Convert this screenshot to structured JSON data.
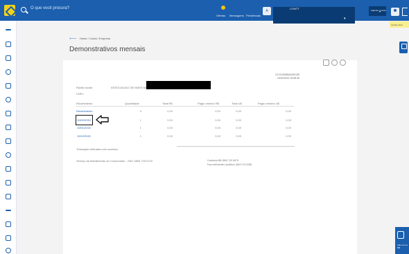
{
  "topbar": {
    "search_placeholder": "O que você procura?",
    "links": [
      "Ofertas",
      "Mensagens",
      "Pendências"
    ],
    "agency_initial": "A",
    "account_label": "CONTT",
    "user_label": "Agência • Conta"
  },
  "version_badge": "Versão atual",
  "chat_label": "Fale com a BB",
  "breadcrumb": {
    "home": "Home",
    "separator": " / ",
    "section": "Conta",
    "sub": "Empresa"
  },
  "page_title": "Demonstrativos mensais",
  "meta": {
    "line1": "CCO19305644000135",
    "line2": "15/02/2022 15:58:35"
  },
  "fields": {
    "razao_social_label": "Razão social",
    "razao_social_value": "ASSOCIACAO DE MAES MOA (A4)",
    "cnpj_label": "CNPJ"
  },
  "table": {
    "headers": [
      "Recebimento",
      "Quantidade",
      "Total R$",
      "Pagto mínimo R$",
      "Total U$",
      "Pagto mínimo U$"
    ],
    "rows": [
      [
        "Recebimento",
        "0",
        "0,00",
        "0,00",
        "0,00",
        "0,00"
      ],
      [
        "10/02/2022",
        "1",
        "0,00",
        "0,00",
        "0,00",
        "0,00"
      ],
      [
        "10/01/2022",
        "1",
        "0,00",
        "0,00",
        "0,00",
        "0,00"
      ],
      [
        "10/12/2021",
        "1",
        "0,00",
        "0,00",
        "0,00",
        "0,00"
      ]
    ]
  },
  "footer": {
    "note": "Transação efetuada com sucesso",
    "sac": "Serviço de Atendimento ao Consumidor - SAC 0800 729 0722",
    "ouvidoria": "Ouvidoria BB 0800 729 5678",
    "deficientes": "Para deficientes auditivos 0800 729 0088"
  }
}
